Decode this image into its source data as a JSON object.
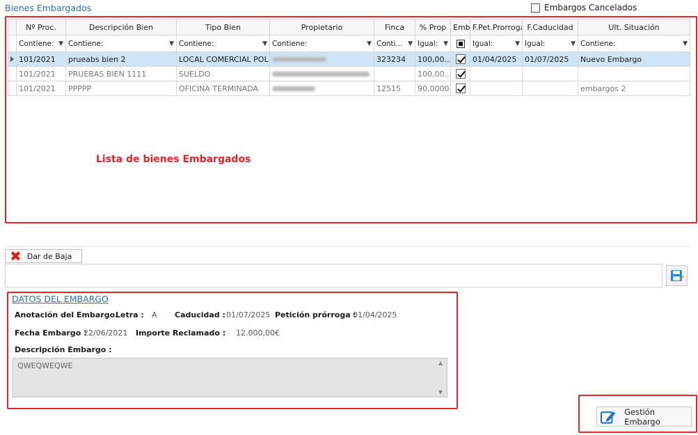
{
  "section_title": "Bienes Embargados",
  "cancelados_label": "Embargos Cancelados",
  "columns": [
    "Nº Proc.",
    "Descripción Bien",
    "Tipo Bien",
    "Propietario",
    "Finca",
    "% Prop",
    "Emb.",
    "F.Pet.Prorroga",
    "F.Caducidad",
    "Ult. Situación"
  ],
  "filters": [
    "Contiene:",
    "Contiene:",
    "Contiene:",
    "Contiene:",
    "Conti...",
    "Igual:",
    "",
    "Igual:",
    "Igual:",
    "Contiene:"
  ],
  "rows": [
    {
      "proc": "101/2021",
      "desc": "prueabs bien 2",
      "tipo": "LOCAL COMERCIAL POL...",
      "finca": "323234",
      "prop": "100,00...",
      "pet": "01/04/2025",
      "cad": "01/07/2025",
      "sit": "Nuevo Embargo"
    },
    {
      "proc": "101/2021",
      "desc": "PRUEBAS BIEN 1111",
      "tipo": "SUELDO",
      "finca": "",
      "prop": "100,00...",
      "pet": "",
      "cad": "",
      "sit": ""
    },
    {
      "proc": "101/2021",
      "desc": "PPPPP",
      "tipo": "OFICINA TERMINADA",
      "finca": "12515",
      "prop": "90,0000",
      "pet": "",
      "cad": "",
      "sit": "embargos 2"
    }
  ],
  "list_placeholder": "Lista de bienes Embargados",
  "baja_label": "Dar de Baja",
  "datos": {
    "title": "DATOS DEL EMBARGO",
    "anotacion_label": "Anotación del Embargo.",
    "letra_label": "Letra :",
    "letra_value": "A",
    "caducidad_label": "Caducidad :",
    "caducidad_value": "01/07/2025",
    "peticion_label": "Petición prórroga :",
    "peticion_value": "01/04/2025",
    "fecha_label": "Fecha Embargo :",
    "fecha_value": "22/06/2021",
    "importe_label": "Importe Reclamado :",
    "importe_value": "12.000,00€",
    "descripcion_label": "Descripción Embargo :",
    "descripcion_value": "QWEQWEQWE"
  },
  "gestion_label": "Gestión Embargo",
  "colors": {
    "accent": "#2a6fb5",
    "highlight": "#e5242a",
    "selected_row": "#cfe5f5"
  }
}
